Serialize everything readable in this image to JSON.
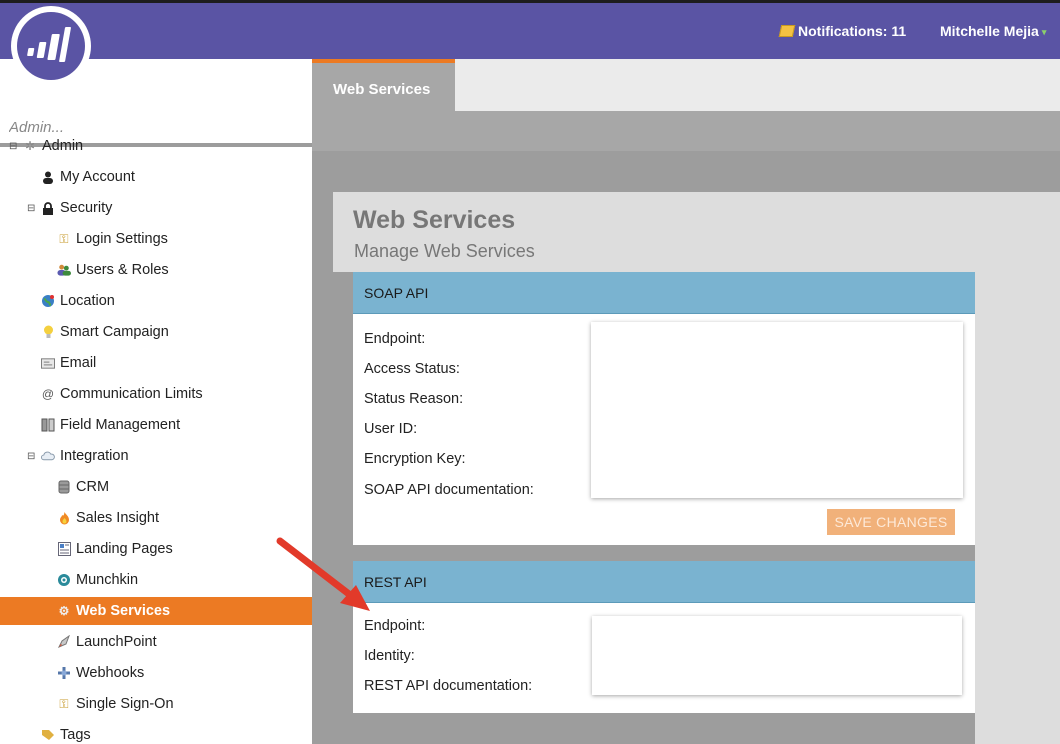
{
  "topbar": {
    "notifications_label": "Notifications: 11",
    "user_name": "Mitchelle Mejia",
    "colors": {
      "bar": "#5a54a4",
      "user_caret": "#8bd06b"
    }
  },
  "sidebar": {
    "search_placeholder": "Admin...",
    "items": [
      {
        "label": "Admin",
        "icon": "gear-icon",
        "toggle": "⊟"
      },
      {
        "label": "My Account",
        "icon": "person-icon"
      },
      {
        "label": "Security",
        "icon": "lock-icon",
        "toggle": "⊟"
      },
      {
        "label": "Login Settings",
        "icon": "key-icon"
      },
      {
        "label": "Users & Roles",
        "icon": "users-icon"
      },
      {
        "label": "Location",
        "icon": "globe-icon"
      },
      {
        "label": "Smart Campaign",
        "icon": "lightbulb-icon"
      },
      {
        "label": "Email",
        "icon": "email-icon"
      },
      {
        "label": "Communication Limits",
        "icon": "at-sign-icon"
      },
      {
        "label": "Field Management",
        "icon": "fields-icon"
      },
      {
        "label": "Integration",
        "icon": "cloud-icon",
        "toggle": "⊟"
      },
      {
        "label": "CRM",
        "icon": "database-icon"
      },
      {
        "label": "Sales Insight",
        "icon": "flame-icon"
      },
      {
        "label": "Landing Pages",
        "icon": "page-icon"
      },
      {
        "label": "Munchkin",
        "icon": "munchkin-icon"
      },
      {
        "label": "Web Services",
        "icon": "gears-icon"
      },
      {
        "label": "LaunchPoint",
        "icon": "rocket-icon"
      },
      {
        "label": "Webhooks",
        "icon": "webhook-icon"
      },
      {
        "label": "Single Sign-On",
        "icon": "key-icon"
      },
      {
        "label": "Tags",
        "icon": "tag-icon"
      }
    ],
    "selected_color": "#ec7a23"
  },
  "tabs": [
    {
      "label": "Web Services",
      "accent": "#ec7a23"
    }
  ],
  "page": {
    "title": "Web Services",
    "subtitle": "Manage Web Services"
  },
  "soap_panel": {
    "heading": "SOAP API",
    "fields": [
      "Endpoint:",
      "Access Status:",
      "Status Reason:",
      "User ID:",
      "Encryption Key:",
      "SOAP API documentation:"
    ],
    "save_button": "SAVE CHANGES",
    "header_color": "#7ab3d0"
  },
  "rest_panel": {
    "heading": "REST API",
    "fields": [
      "Endpoint:",
      "Identity:",
      "REST API documentation:"
    ]
  },
  "annotation": {
    "arrow_color": "#e23a2a"
  }
}
